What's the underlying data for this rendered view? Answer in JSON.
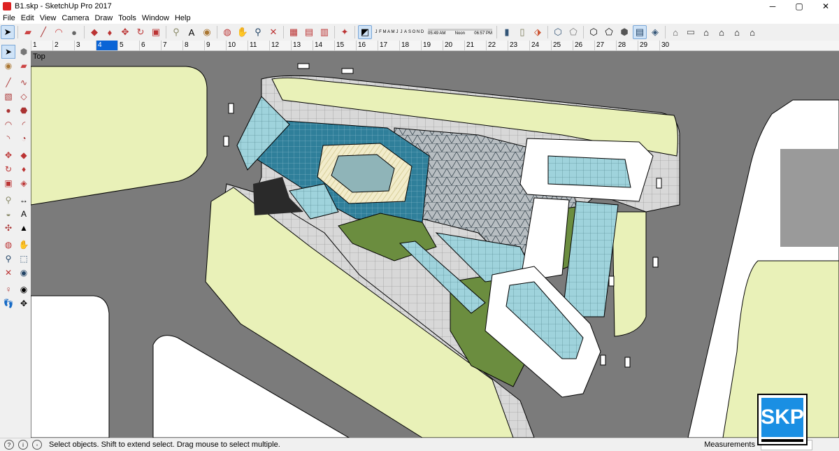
{
  "window": {
    "title": "B1.skp - SketchUp Pro 2017",
    "minimize": "─",
    "maximize": "▢",
    "close": "✕"
  },
  "menu": [
    "File",
    "Edit",
    "View",
    "Camera",
    "Draw",
    "Tools",
    "Window",
    "Help"
  ],
  "shadow": {
    "months": [
      "J",
      "F",
      "M",
      "A",
      "M",
      "J",
      "J",
      "A",
      "S",
      "O",
      "N",
      "D"
    ],
    "time_start": "05:49 AM",
    "time_mid": "Noon",
    "time_end": "06:57 PM"
  },
  "scenes": {
    "tabs": [
      "1",
      "2",
      "3",
      "4",
      "5",
      "6",
      "7",
      "8",
      "9",
      "10",
      "11",
      "12",
      "13",
      "14",
      "15",
      "16",
      "17",
      "18",
      "19",
      "20",
      "21",
      "22",
      "23",
      "24",
      "25",
      "26",
      "27",
      "28",
      "29",
      "30"
    ],
    "active": "4"
  },
  "viewport": {
    "label": "Top"
  },
  "status": {
    "message": "Select objects. Shift to extend select. Drag mouse to select multiple.",
    "measurements_label": "Measurements"
  },
  "badge": {
    "text": "SKP"
  },
  "colors": {
    "road": "#7b7b7b",
    "lawn": "#e9f1b8",
    "blue_roof": "#2f7f9a",
    "glass": "#9fd3dc",
    "dark_green": "#6b8d3f",
    "accent": "#0a64d6"
  }
}
